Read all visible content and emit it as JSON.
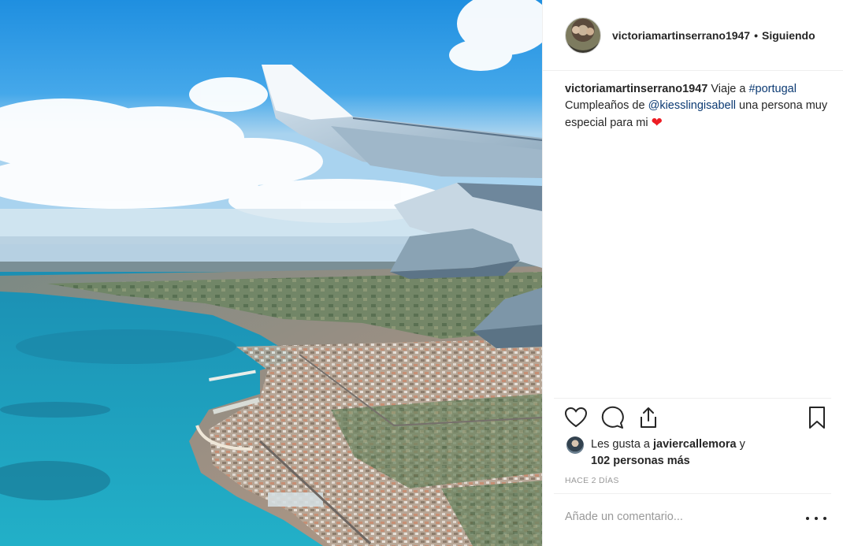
{
  "post": {
    "username": "victoriamartinserrano1947",
    "follow_status": "Siguiendo",
    "separator": "•",
    "caption": {
      "username": "victoriamartinserrano1947",
      "text_1": " Viaje a ",
      "hashtag": "#portugal",
      "text_2": "Cumpleaños de ",
      "mention": "@kiesslingisabell",
      "text_3": " una persona muy especial para mi ",
      "emoji": "❤"
    },
    "likes": {
      "prefix": "Les gusta a ",
      "first_liker": "javiercallemora",
      "joiner": " y ",
      "others": "102 personas más"
    },
    "timestamp": "HACE 2 DÍAS",
    "comment_placeholder": "Añade un comentario...",
    "icons": {
      "like": "heart-icon",
      "comment": "comment-icon",
      "share": "share-icon",
      "save": "bookmark-icon",
      "more": "more-options-icon"
    },
    "colors": {
      "link": "#0b3a73",
      "heart": "#ed1c24",
      "muted": "#999999",
      "text": "#262626"
    }
  }
}
